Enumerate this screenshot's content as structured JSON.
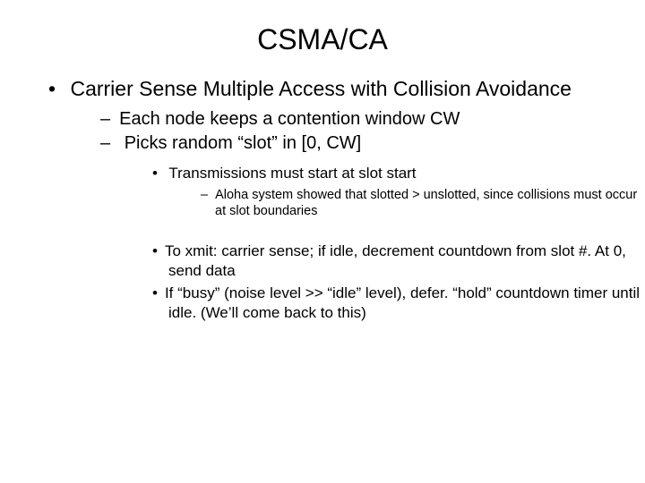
{
  "title": "CSMA/CA",
  "l1": {
    "item1": "Carrier Sense Multiple Access with Collision Avoidance"
  },
  "l2": {
    "item1": "Each node keeps a contention window CW",
    "item2": "Picks random “slot” in [0, CW]"
  },
  "l3a": {
    "item1": "Transmissions must start at slot start"
  },
  "l4": {
    "item1": "Aloha system showed that slotted > unslotted, since collisions must occur at slot boundaries"
  },
  "l3b": {
    "item1": "To xmit:  carrier sense;  if idle, decrement countdown from slot #.  At 0, send data",
    "item2": "If “busy” (noise level >> “idle” level), defer.  “hold” countdown timer until idle.  (We’ll come back to this)"
  }
}
